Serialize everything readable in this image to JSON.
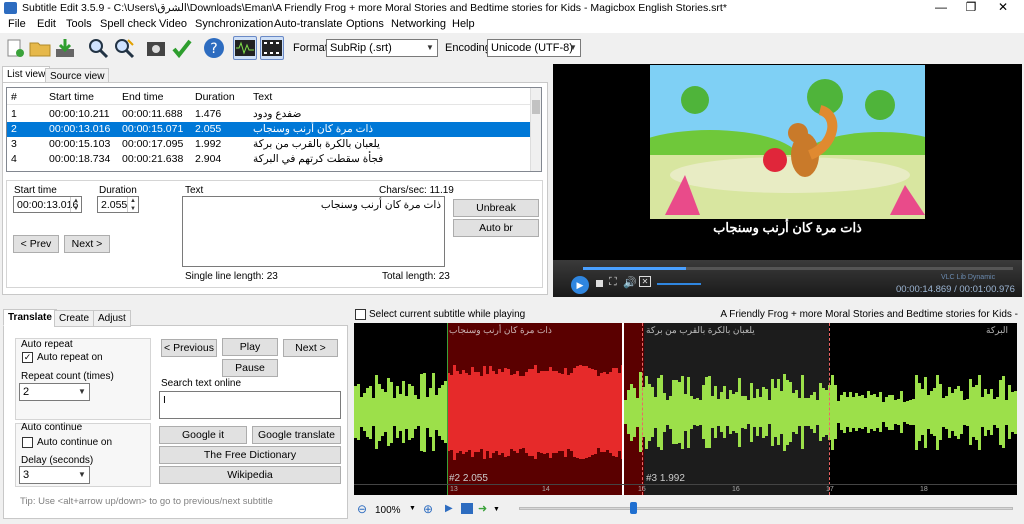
{
  "window": {
    "title": "Subtitle Edit 3.5.9 - C:\\Users\\الشرق\\Downloads\\Eman\\A Friendly Frog + more Moral Stories and Bedtime stories for Kids - Magicbox English Stories.srt*",
    "minimize": "—",
    "restore": "❐",
    "close": "✕"
  },
  "menu": [
    "File",
    "Edit",
    "Tools",
    "Spell check",
    "Video",
    "Synchronization",
    "Auto-translate",
    "Options",
    "Networking",
    "Help"
  ],
  "toolbar": {
    "format_label": "Format",
    "format_value": "SubRip (.srt)",
    "encoding_label": "Encoding",
    "encoding_value": "Unicode (UTF-8)"
  },
  "view_tabs": [
    "List view",
    "Source view"
  ],
  "columns": [
    "#",
    "Start time",
    "End time",
    "Duration",
    "Text"
  ],
  "rows": [
    {
      "n": "1",
      "start": "00:00:10.211",
      "end": "00:00:11.688",
      "dur": "1.476",
      "text": "ضفدع ودود"
    },
    {
      "n": "2",
      "start": "00:00:13.016",
      "end": "00:00:15.071",
      "dur": "2.055",
      "text": "ذات مرة كان أرنب وسنجاب"
    },
    {
      "n": "3",
      "start": "00:00:15.103",
      "end": "00:00:17.095",
      "dur": "1.992",
      "text": "يلعبان بالكرة بالقرب من بركة"
    },
    {
      "n": "4",
      "start": "00:00:18.734",
      "end": "00:00:21.638",
      "dur": "2.904",
      "text": "فجأة سقطت كرتهم في البركة"
    }
  ],
  "edit": {
    "start_label": "Start time",
    "start_value": "00:00:13.016",
    "duration_label": "Duration",
    "duration_value": "2.055",
    "text_label": "Text",
    "chars_sec": "Chars/sec: 11.19",
    "text_value": "ذات مرة كان أرنب وسنجاب",
    "unbreak": "Unbreak",
    "auto_br": "Auto br",
    "prev": "< Prev",
    "next": "Next >",
    "single_line": "Single line length: 23",
    "total_length": "Total length: 23"
  },
  "video": {
    "subtitle": "ذات مرة كان أرنب وسنجاب",
    "time": "00:00:14.869 / 00:01:00.976",
    "vlc": "VLC Lib Dynamic"
  },
  "bottom_tabs": [
    "Translate",
    "Create",
    "Adjust"
  ],
  "translate": {
    "auto_repeat_group": "Auto repeat",
    "auto_repeat_on": "Auto repeat on",
    "repeat_count_label": "Repeat count (times)",
    "repeat_count": "2",
    "auto_continue_group": "Auto continue",
    "auto_continue_on": "Auto continue on",
    "delay_label": "Delay (seconds)",
    "delay": "3",
    "previous": "< Previous",
    "play": "Play",
    "next": "Next >",
    "pause": "Pause",
    "search_label": "Search text online",
    "search_value": "I",
    "google_it": "Google it",
    "google_translate": "Google translate",
    "free_dictionary": "The Free Dictionary",
    "wikipedia": "Wikipedia",
    "tip": "Tip: Use <alt+arrow up/down> to go to previous/next subtitle"
  },
  "waveform": {
    "select_current": "Select current subtitle while playing",
    "media_title": "A Friendly Frog + more Moral Stories and Bedtime stories for Kids -",
    "label2": "#2  2.055",
    "label3": "#3  1.992",
    "t13": "13",
    "t14": "14",
    "t15": "15",
    "t16": "16",
    "t17": "17",
    "t18": "18",
    "sub_a": "ذات مرة كان أرنب وسنجاب",
    "sub_b": "يلعبان بالكرة بالقرب من بركة",
    "sub_c": "البركة",
    "zoom": "100%"
  },
  "colors": {
    "accent": "#0078d7",
    "wave_green": "#9ce04a",
    "wave_red": "#e62a2a"
  }
}
